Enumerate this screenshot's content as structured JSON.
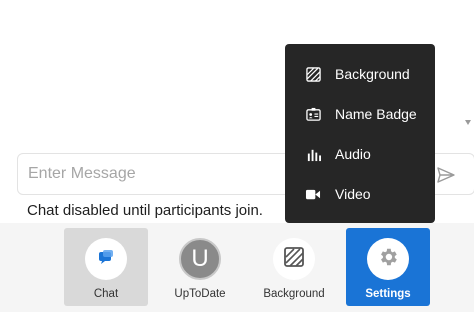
{
  "composer": {
    "placeholder": "Enter Message",
    "value": ""
  },
  "status": {
    "text": "Chat disabled until participants join."
  },
  "toolbar": {
    "chat_label": "Chat",
    "participant_label": "UpToDate",
    "participant_initial": "U",
    "background_label": "Background",
    "settings_label": "Settings"
  },
  "settings_menu": {
    "items": [
      {
        "label": "Background",
        "icon": "background-icon"
      },
      {
        "label": "Name Badge",
        "icon": "badge-icon"
      },
      {
        "label": "Audio",
        "icon": "audio-icon"
      },
      {
        "label": "Video",
        "icon": "video-camera-icon"
      }
    ]
  },
  "colors": {
    "accent": "#1a74d6",
    "menu_bg": "#262626",
    "toolbar_bg": "#f5f5f5",
    "chat_active_bg": "#d9d9d9"
  }
}
